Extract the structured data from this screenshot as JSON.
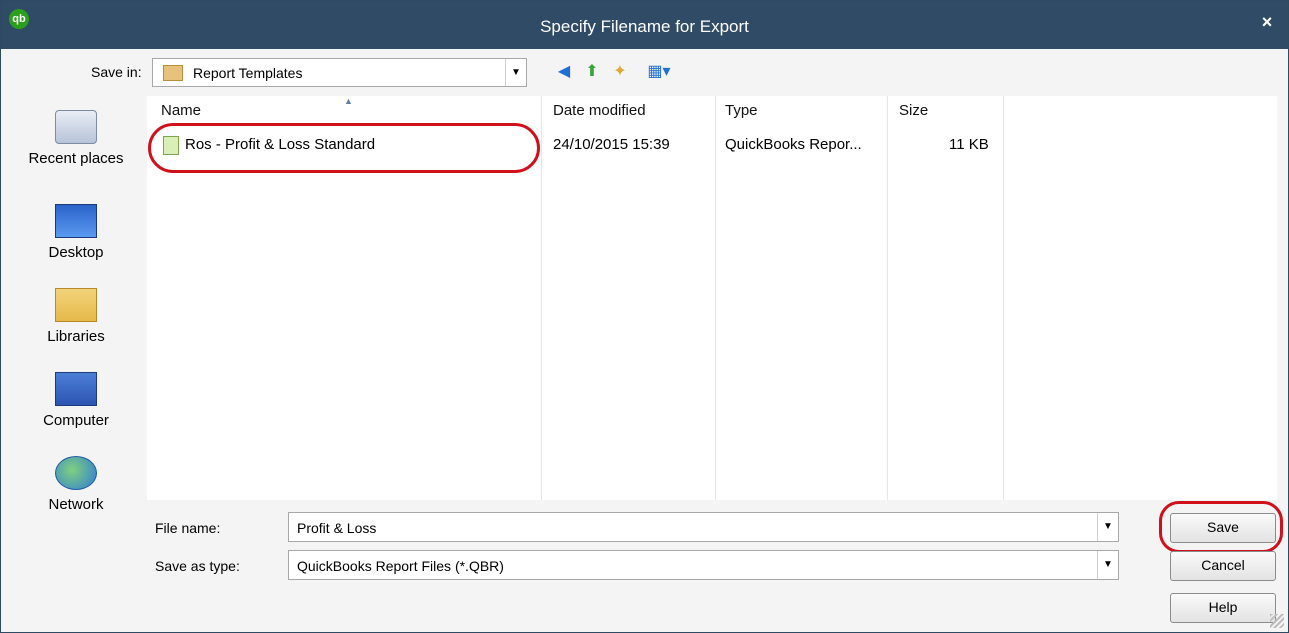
{
  "window": {
    "title": "Specify Filename for Export",
    "app_icon_text": "qb",
    "close_glyph": "×"
  },
  "toolbar": {
    "save_in_label": "Save in:",
    "save_in_value": "Report Templates",
    "icons": [
      "back-icon",
      "up-folder-icon",
      "new-folder-icon",
      "view-menu-icon"
    ]
  },
  "places": [
    {
      "label": "Recent places",
      "icon": "recent-places-icon"
    },
    {
      "label": "Desktop",
      "icon": "desktop-icon"
    },
    {
      "label": "Libraries",
      "icon": "libraries-icon"
    },
    {
      "label": "Computer",
      "icon": "computer-icon"
    },
    {
      "label": "Network",
      "icon": "network-icon"
    }
  ],
  "filelist": {
    "columns": [
      "Name",
      "Date modified",
      "Type",
      "Size"
    ],
    "rows": [
      {
        "name": "Ros - Profit & Loss Standard",
        "date": "24/10/2015 15:39",
        "type": "QuickBooks Repor...",
        "size": "11 KB"
      }
    ]
  },
  "form": {
    "file_name_label": "File name:",
    "file_name_value": "Profit & Loss",
    "save_type_label": "Save as type:",
    "save_type_value": "QuickBooks Report Files (*.QBR)"
  },
  "buttons": {
    "save": "Save",
    "cancel": "Cancel",
    "help": "Help"
  },
  "colors": {
    "titlebar": "#2f4b66",
    "highlight": "#d0101a"
  }
}
